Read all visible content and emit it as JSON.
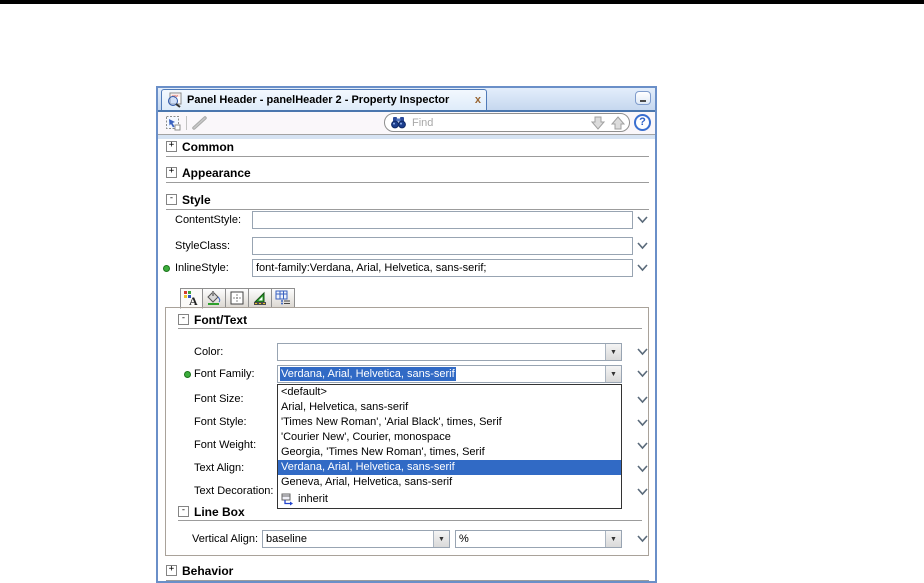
{
  "window": {
    "tab_title": "Panel Header - panelHeader 2 - Property Inspector",
    "tab_close": "x"
  },
  "toolbar": {
    "find_placeholder": "Find",
    "help_label": "?"
  },
  "sections": {
    "common": {
      "label": "Common",
      "state": "+"
    },
    "appearance": {
      "label": "Appearance",
      "state": "+"
    },
    "style": {
      "label": "Style",
      "state": "-"
    },
    "behavior": {
      "label": "Behavior",
      "state": "+"
    }
  },
  "style_section": {
    "fields": [
      {
        "label": "ContentStyle:",
        "value": ""
      },
      {
        "label": "StyleClass:",
        "value": ""
      },
      {
        "label": "InlineStyle:",
        "value": "font-family:Verdana, Arial, Helvetica, sans-serif;"
      }
    ]
  },
  "font_text": {
    "header": "Font/Text",
    "state": "-",
    "color_label": "Color:",
    "color_value": "",
    "font_family_label": "Font Family:",
    "font_family_value": "Verdana, Arial, Helvetica, sans-serif",
    "font_size_label": "Font Size:",
    "font_style_label": "Font Style:",
    "font_weight_label": "Font Weight:",
    "text_align_label": "Text Align:",
    "text_decoration_label": "Text Decoration:"
  },
  "font_family_dropdown": {
    "items": [
      "<default>",
      "Arial, Helvetica, sans-serif",
      "'Times New Roman', 'Arial Black', times, Serif",
      "'Courier New', Courier, monospace",
      "Georgia, 'Times New Roman', times, Serif",
      "Verdana, Arial, Helvetica, sans-serif",
      "Geneva, Arial, Helvetica, sans-serif"
    ],
    "inherit_item": "inherit",
    "selected_index": 5
  },
  "line_box": {
    "header": "Line Box",
    "state": "-",
    "vertical_align_label": "Vertical Align:",
    "vertical_align_value": "baseline",
    "unit_value": "%"
  },
  "colors": {
    "selection_blue": "#316ac5",
    "modified_green": "#3cae3c",
    "window_border_blue": "#6a8fc8"
  }
}
